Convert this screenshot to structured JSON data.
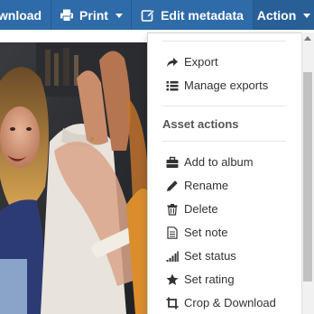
{
  "toolbar": {
    "download_label": "wnload",
    "print_label": "Print",
    "edit_label": "Edit metadata",
    "action_label": "Action"
  },
  "menu": {
    "items_top": [
      {
        "label": "Export",
        "icon": "share-icon"
      },
      {
        "label": "Manage exports",
        "icon": "list-icon"
      }
    ],
    "section_header": "Asset actions",
    "items": [
      {
        "label": "Add to album",
        "icon": "briefcase-icon"
      },
      {
        "label": "Rename",
        "icon": "pencil-icon"
      },
      {
        "label": "Delete",
        "icon": "trash-icon"
      },
      {
        "label": "Set note",
        "icon": "note-icon"
      },
      {
        "label": "Set status",
        "icon": "signal-icon"
      },
      {
        "label": "Set rating",
        "icon": "star-icon"
      },
      {
        "label": "Crop & Download",
        "icon": "crop-icon"
      }
    ]
  },
  "colors": {
    "toolbar": "#2f6ba8",
    "toolbar_active": "#295f97",
    "menu_text": "#333333"
  }
}
